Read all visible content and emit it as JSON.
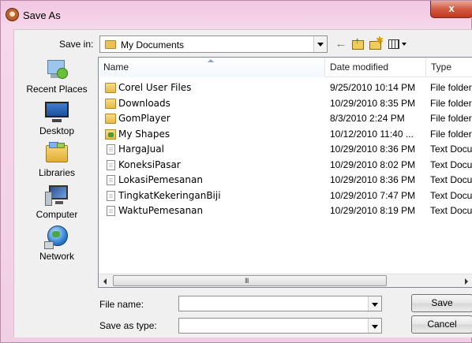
{
  "window": {
    "title": "Save As",
    "close_label": "x"
  },
  "save_in": {
    "label": "Save in:",
    "value": "My Documents"
  },
  "toolbar": {
    "back_icon": "back-arrow-icon",
    "up_icon": "up-one-level-icon",
    "new_folder_icon": "new-folder-icon",
    "views_icon": "views-menu-icon"
  },
  "places": [
    {
      "label": "Recent Places",
      "icon": "recent-places-icon"
    },
    {
      "label": "Desktop",
      "icon": "desktop-icon"
    },
    {
      "label": "Libraries",
      "icon": "libraries-icon"
    },
    {
      "label": "Computer",
      "icon": "computer-icon"
    },
    {
      "label": "Network",
      "icon": "network-icon"
    }
  ],
  "file_list": {
    "columns": [
      "Name",
      "Date modified",
      "Type"
    ],
    "rows": [
      {
        "name": "Corel User Files",
        "date": "9/25/2010 10:14 PM",
        "type": "File folder",
        "icon": "folder"
      },
      {
        "name": "Downloads",
        "date": "10/29/2010 8:35 PM",
        "type": "File folder",
        "icon": "folder"
      },
      {
        "name": "GomPlayer",
        "date": "8/3/2010 2:24 PM",
        "type": "File folder",
        "icon": "folder"
      },
      {
        "name": "My Shapes",
        "date": "10/12/2010 11:40 ...",
        "type": "File folder",
        "icon": "special"
      },
      {
        "name": "HargaJual",
        "date": "10/29/2010 8:36 PM",
        "type": "Text Docu",
        "icon": "text"
      },
      {
        "name": "KoneksiPasar",
        "date": "10/29/2010 8:02 PM",
        "type": "Text Docu",
        "icon": "text"
      },
      {
        "name": "LokasiPemesanan",
        "date": "10/29/2010 8:36 PM",
        "type": "Text Docu",
        "icon": "text"
      },
      {
        "name": "TingkatKekeringanBiji",
        "date": "10/29/2010 7:47 PM",
        "type": "Text Docu",
        "icon": "text"
      },
      {
        "name": "WaktuPemesanan",
        "date": "10/29/2010 8:19 PM",
        "type": "Text Docu",
        "icon": "text"
      }
    ]
  },
  "scrollbar": {
    "grip": "III"
  },
  "file_name": {
    "label": "File name:",
    "value": ""
  },
  "save_as_type": {
    "label": "Save as type:",
    "value": ""
  },
  "buttons": {
    "save": "Save",
    "cancel": "Cancel"
  }
}
